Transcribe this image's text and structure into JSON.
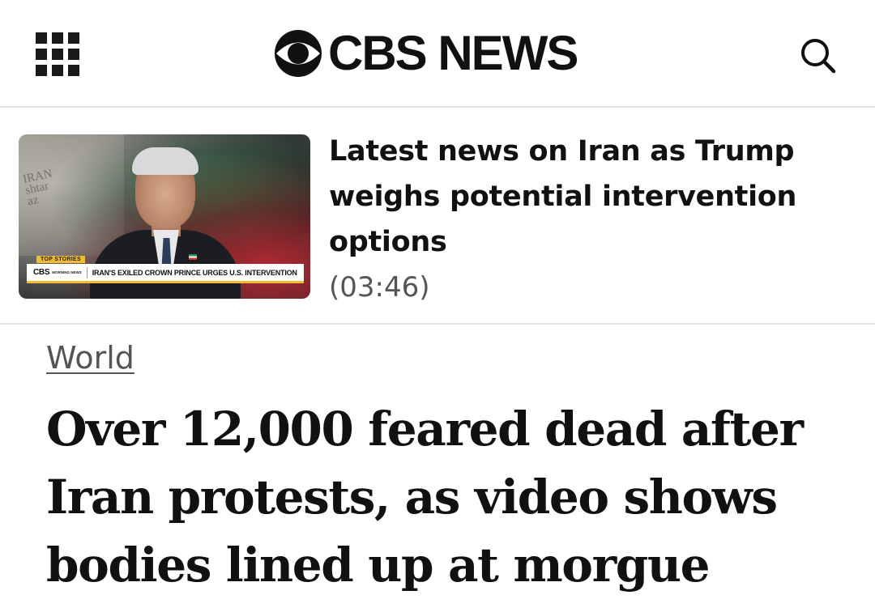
{
  "header": {
    "brand": "CBS NEWS",
    "menu_icon": "grid-menu-icon",
    "logo_icon": "cbs-eye-icon",
    "search_icon": "search-icon"
  },
  "promo": {
    "title": "Latest news on Iran as Trump weighs potential intervention options",
    "duration": "(03:46)",
    "thumbnail": {
      "badge": "TOP STORIES",
      "logo_text": "CBS",
      "logo_sub": "MORNING NEWS",
      "chyron": "IRAN'S EXILED CROWN PRINCE URGES U.S. INTERVENTION"
    }
  },
  "article": {
    "section": "World",
    "headline": "Over 12,000 feared dead after Iran protests, as video shows bodies lined up at morgue"
  },
  "colors": {
    "accent_yellow": "#f1bb32",
    "divider": "#e3e3e3",
    "text": "#111111",
    "muted": "#555555"
  }
}
